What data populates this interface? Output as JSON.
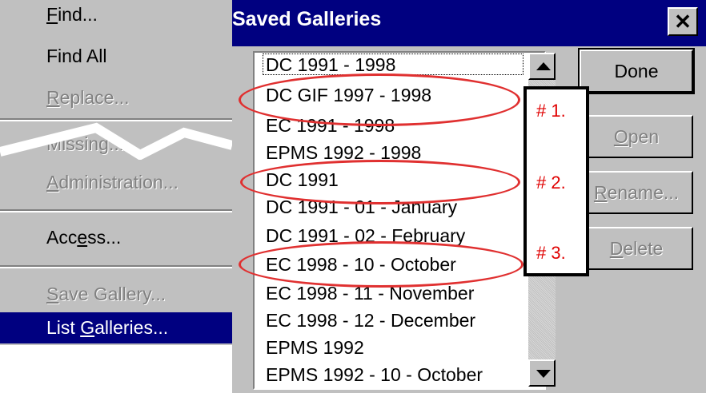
{
  "menu": {
    "items": [
      {
        "label_pre": "",
        "accel": "F",
        "label_post": "ind..."
      },
      {
        "label": "Find All"
      },
      {
        "label_pre": "",
        "accel": "R",
        "label_post": "eplace..."
      },
      {
        "label": "Missing..."
      },
      {
        "label_pre": "",
        "accel": "A",
        "label_post": "dministration..."
      },
      {
        "label_pre": "Acc",
        "accel": "e",
        "label_post": "ss..."
      },
      {
        "label_pre": "",
        "accel": "S",
        "label_post": "ave Gallery..."
      },
      {
        "label_pre": "List ",
        "accel": "G",
        "label_post": "alleries..."
      }
    ]
  },
  "dialog": {
    "title": "Saved Galleries",
    "close_glyph": "✕",
    "list_items": [
      "DC 1991 - 1998",
      "DC GIF 1997 - 1998",
      "EC 1991 - 1998",
      "EPMS 1992 - 1998",
      "DC 1991",
      "DC 1991 - 01 - January",
      "DC 1991 - 02 - February",
      "EC 1998 - 10 - October",
      "EC 1998 - 11 - November",
      "EC 1998 - 12 - December",
      "EPMS 1992",
      "EPMS 1992 - 10 - October"
    ],
    "buttons": {
      "done": "Done",
      "open_pre": "",
      "open_accel": "O",
      "open_post": "pen",
      "rename_pre": "",
      "rename_accel": "R",
      "rename_post": "ename...",
      "delete_pre": "",
      "delete_accel": "D",
      "delete_post": "elete"
    }
  },
  "annotations": {
    "note1": "# 1.",
    "note2": "# 2.",
    "note3": "# 3.",
    "color": "#e00000"
  }
}
